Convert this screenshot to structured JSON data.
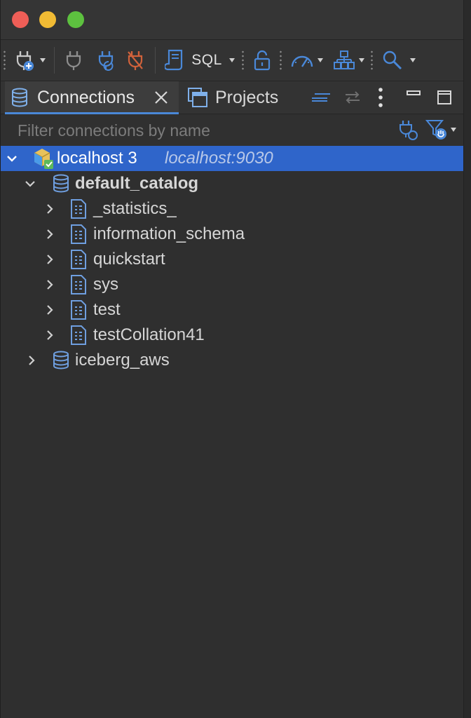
{
  "window": {
    "traffic": [
      "close",
      "minimize",
      "maximize"
    ]
  },
  "toolbar": {
    "sql_label": "SQL",
    "icons": [
      "new-connection-icon",
      "connect-icon",
      "reconnect-icon",
      "disconnect-icon",
      "sql-editor-icon",
      "lock-icon",
      "dashboard-icon",
      "hierarchy-icon",
      "search-icon"
    ]
  },
  "tabs": {
    "connections": "Connections",
    "projects": "Projects"
  },
  "filter": {
    "placeholder": "Filter connections by name"
  },
  "tree": {
    "connection": {
      "name": "localhost 3",
      "address": "localhost:9030"
    },
    "catalog": "default_catalog",
    "schemas": [
      "_statistics_",
      "information_schema",
      "quickstart",
      "sys",
      "test",
      "testCollation41"
    ],
    "other_catalog": "iceberg_aws"
  },
  "colors": {
    "selection": "#2f65ca",
    "accent": "#4a88d8"
  }
}
